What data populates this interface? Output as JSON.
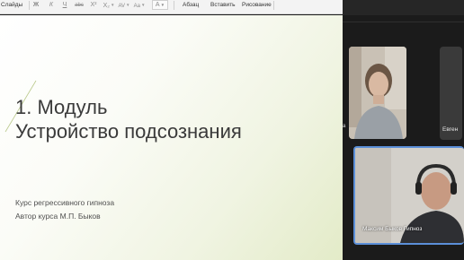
{
  "ribbon": {
    "slides_label": "Слайды",
    "format_buttons": [
      {
        "glyph": "Ж",
        "dropdown": false
      },
      {
        "glyph": "К",
        "dropdown": false
      },
      {
        "glyph": "Ч",
        "dropdown": false
      },
      {
        "glyph": "abc",
        "dropdown": false
      },
      {
        "glyph": "X²",
        "dropdown": false
      },
      {
        "glyph": "X₂",
        "dropdown": true
      },
      {
        "glyph": "AV",
        "dropdown": true
      },
      {
        "glyph": "Aa",
        "dropdown": true
      }
    ],
    "font_color_glyph": "A",
    "paragraph_label": "Абзац",
    "insert_label": "Вставить",
    "draw_label": "Рисование"
  },
  "slide": {
    "title_line1": "1. Модуль",
    "title_line2": "Устройство подсознания",
    "subtitle_line1": "Курс регрессивного гипноза",
    "subtitle_line2": "Автор курса М.П. Быков"
  },
  "participants": {
    "left_edge_name": "а",
    "tile_right_name": "Евген",
    "active_speaker_name": "Максим Быков Гипноз",
    "active_color": "#5b8fd8"
  }
}
